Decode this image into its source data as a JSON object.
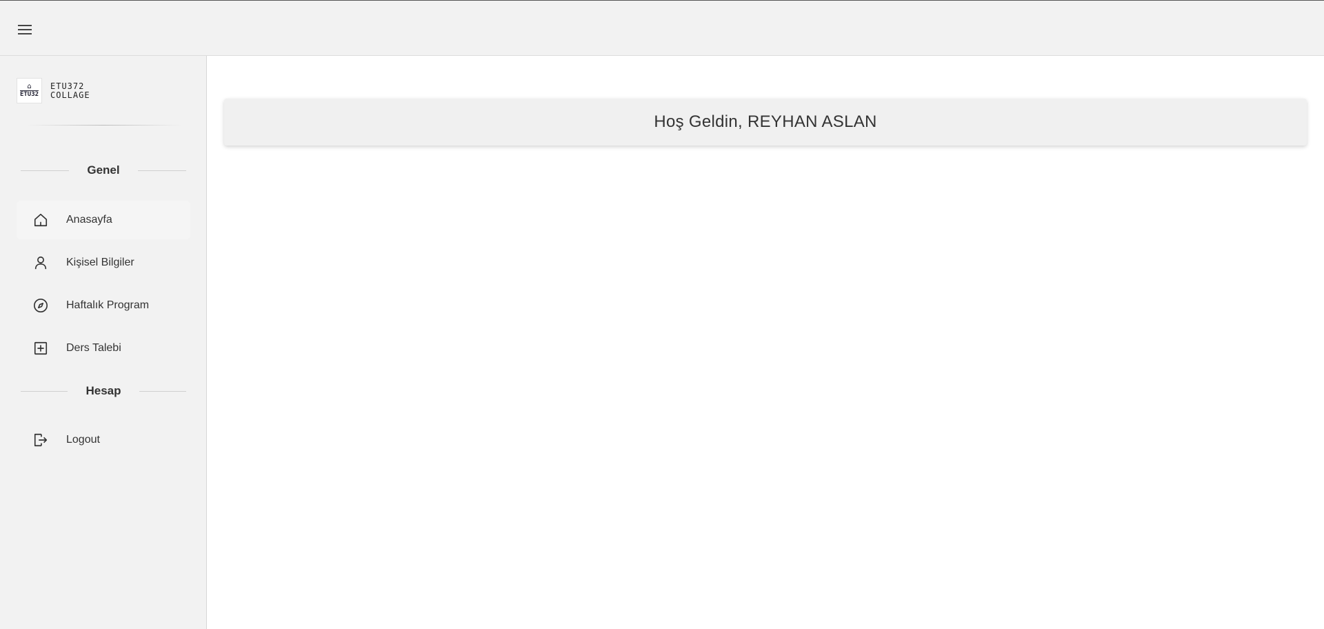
{
  "topbar": {
    "menu_icon": "hamburger-icon"
  },
  "brand": {
    "logo_mark": "⌂",
    "logo_code": "ETU32",
    "name": "ETU372 COLLAGE"
  },
  "sidebar": {
    "section_general": "Genel",
    "items": [
      {
        "label": "Anasayfa",
        "icon": "home-icon",
        "active": true
      },
      {
        "label": "Kişisel Bilgiler",
        "icon": "user-icon",
        "active": false
      },
      {
        "label": "Haftalık Program",
        "icon": "compass-icon",
        "active": false
      },
      {
        "label": "Ders Talebi",
        "icon": "plus-square-icon",
        "active": false
      }
    ],
    "section_account": "Hesap",
    "account_items": [
      {
        "label": "Logout",
        "icon": "logout-icon"
      }
    ]
  },
  "main": {
    "welcome": "Hoş Geldin, REYHAN ASLAN"
  }
}
